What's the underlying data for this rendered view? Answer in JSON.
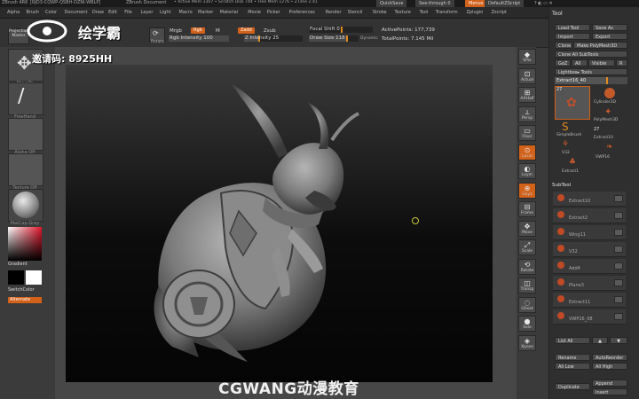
{
  "titlebar": {
    "app": "ZBrush 4R6",
    "id": "[RJD3-CQWP-QSBH-DZNI-WBLP]",
    "doc": "ZBrush Document",
    "stats": "• Active Mem 1307 • Scratch Disk 744 • Free Mem 1276 • ZTime 2.41",
    "quicksave": "QuickSave",
    "seethrough": "See-through 0",
    "menus_btn": "Menus",
    "script": "DefaultZScript"
  },
  "menubar": [
    "Alpha",
    "Brush",
    "Color",
    "Document",
    "Draw",
    "Edit",
    "File",
    "Layer",
    "Light",
    "Macro",
    "Marker",
    "Material",
    "Movie",
    "Picker",
    "Preferences",
    "Render",
    "Stencil",
    "Stroke",
    "Texture",
    "Tool",
    "Transform",
    "Zplugin",
    "Zscript"
  ],
  "toolbar": {
    "projection": "Projection Master",
    "rotate": "Rotate",
    "mrgb": "Mrgb",
    "rgb": "Rgb",
    "m": "M",
    "zadd": "Zadd",
    "zsub": "Zsub",
    "rgb_intensity": "Rgb Intensity 100",
    "z_intensity": "Z Intensity 25",
    "focal_shift": "Focal Shift 0",
    "draw_size": "Draw Size 118",
    "dynamic": "Dynamic",
    "active_points": "ActivePoints: 177,739",
    "total_points": "TotalPoints: 7.145 Mil"
  },
  "leftshelf": {
    "brush_label": "MoveTo",
    "stroke_label": "FreeHand",
    "alpha_label": "Alpha Off",
    "texture_label": "Texture Off",
    "material_label": "MatCap Gray",
    "gradient_label": "Gradient",
    "switchcolor_label": "SwitchColor",
    "alternate_label": "Alternate"
  },
  "rightstrip": [
    "SPix",
    "Actual",
    "AAHalf",
    "Persp",
    "Floor",
    "Local",
    "Lsym",
    "Gxyz",
    "Frame",
    "Move",
    "Scale",
    "Rotate",
    "Transp",
    "Ghost",
    "Solo",
    "Xpose"
  ],
  "toolpanel": {
    "title": "Tool",
    "load": "Load Tool",
    "save": "Save As",
    "import": "Import",
    "export": "Export",
    "clone": "Clone",
    "polymesh": "Make PolyMesh3D",
    "clone_all": "Clone All SubTools",
    "goz": "GoZ",
    "all": "All",
    "visible": "Visible",
    "r": "R",
    "lightbox": "Lightbox▸ Tools",
    "extract_label": "Extract16_40",
    "count1": "27",
    "tools": [
      "Cylinder3D",
      "PolyMesh3D",
      "SimpleBrush",
      "Extract10",
      "V32",
      "VWP16",
      "Extract1"
    ],
    "count2": "27",
    "subtool_header": "SubTool",
    "subtools": [
      "Extract10",
      "Extract2",
      "Wing11",
      "V32",
      "Add4",
      "Plane3",
      "Extract11",
      "VWP16_08"
    ],
    "list_all": "List All",
    "rename": "Rename",
    "autoreorder": "AutoReorder",
    "all_low": "All Low",
    "all_high": "All High",
    "duplicate": "Duplicate",
    "append": "Append",
    "insert": "Insert"
  },
  "watermark": {
    "brand_cn": "绘学霸",
    "code": "邀请码: 8925HH",
    "bottom": "CGWANG动漫教育"
  }
}
